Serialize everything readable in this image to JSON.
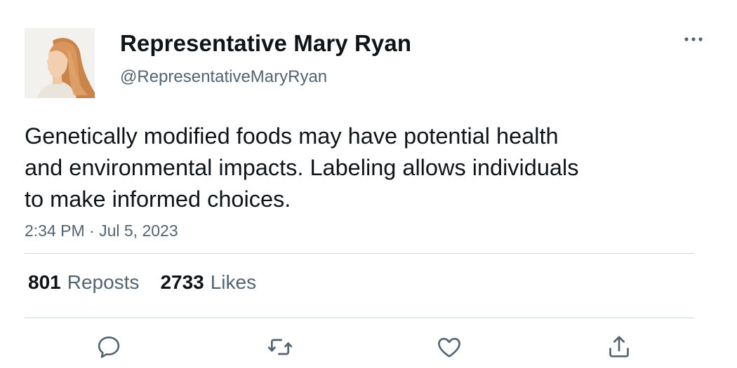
{
  "author": {
    "display_name": "Representative Mary Ryan",
    "handle": "@RepresentativeMaryRyan"
  },
  "tweet": {
    "text": "Genetically modified foods may have potential health\nand environmental impacts. Labeling allows individuals\nto make informed choices.",
    "timestamp": "2:34 PM · Jul 5, 2023"
  },
  "stats": {
    "reposts_count": "801",
    "reposts_label": "Reposts",
    "likes_count": "2733",
    "likes_label": "Likes"
  },
  "actions": {
    "reply_icon": "reply-icon",
    "repost_icon": "repost-icon",
    "like_icon": "heart-icon",
    "share_icon": "share-icon",
    "more_icon": "more-icon"
  },
  "colors": {
    "primary_text": "#0f1419",
    "secondary_text": "#536471",
    "divider": "#cfd9de"
  }
}
